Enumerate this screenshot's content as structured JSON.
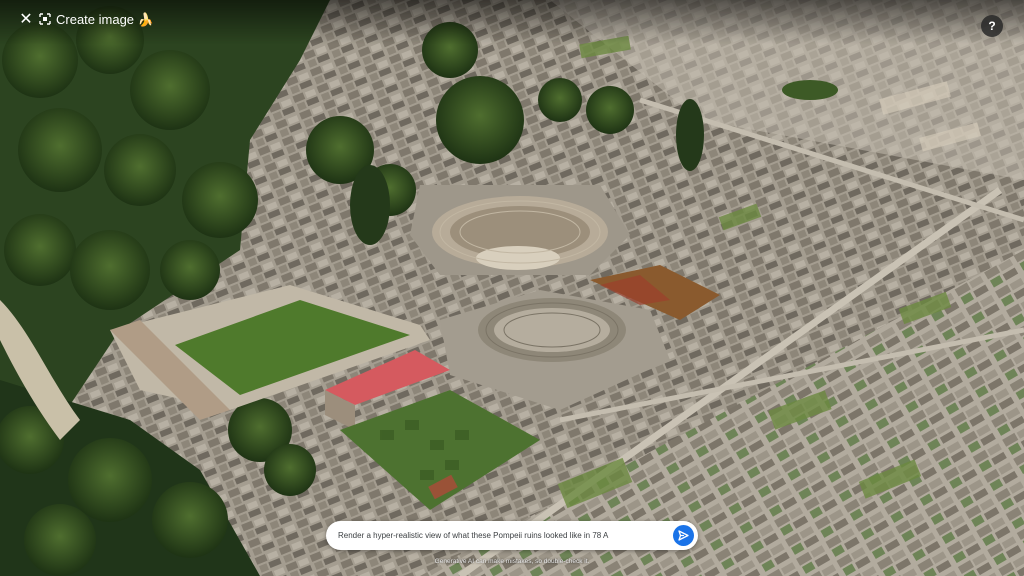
{
  "header": {
    "close_glyph": "✕",
    "close_icon": "close-icon",
    "title_icon": "image-create-icon",
    "title": "Create image 🍌",
    "help_glyph": "?",
    "help_icon": "help-icon"
  },
  "scene": {
    "description_icon": "aerial-3d-map-view"
  },
  "prompt": {
    "value": "Render a hyper-realistic view of what these Pompeii ruins looked like in 78 A",
    "send_icon": "send-icon",
    "accent_color": "#1a73e8"
  },
  "footer": {
    "disclaimer": "Generative AI can make mistakes, so double-check it."
  }
}
